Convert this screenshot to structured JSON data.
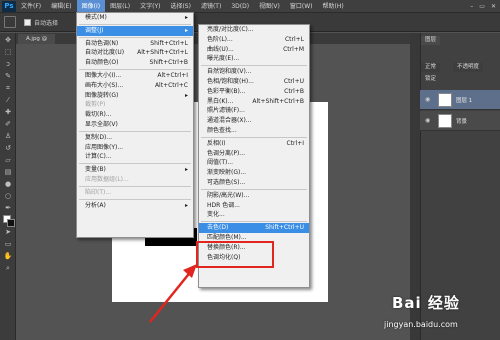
{
  "app": {
    "logo_text": "Ps"
  },
  "menubar": {
    "items": [
      "文件(F)",
      "编辑(E)",
      "图像(I)",
      "图层(L)",
      "文字(Y)",
      "选择(S)",
      "滤镜(T)",
      "3D(D)",
      "视图(V)",
      "窗口(W)",
      "帮助(H)"
    ],
    "active_index": 2,
    "window_controls": [
      "–",
      "▭",
      "✕"
    ]
  },
  "options_bar": {
    "auto_select_label": "自动选择"
  },
  "document": {
    "tab_label": "A.jpg @"
  },
  "image_menu": {
    "items": [
      {
        "label": "模式(M)",
        "shortcut": "",
        "submenu": true,
        "state": "normal"
      },
      {
        "sep": true
      },
      {
        "label": "调整(J)",
        "shortcut": "",
        "submenu": true,
        "state": "highlight"
      },
      {
        "sep": true
      },
      {
        "label": "自动色调(N)",
        "shortcut": "Shift+Ctrl+L",
        "state": "normal"
      },
      {
        "label": "自动对比度(U)",
        "shortcut": "Alt+Shift+Ctrl+L",
        "state": "normal"
      },
      {
        "label": "自动颜色(O)",
        "shortcut": "Shift+Ctrl+B",
        "state": "normal"
      },
      {
        "sep": true
      },
      {
        "label": "图像大小(I)...",
        "shortcut": "Alt+Ctrl+I",
        "state": "normal"
      },
      {
        "label": "画布大小(S)...",
        "shortcut": "Alt+Ctrl+C",
        "state": "normal"
      },
      {
        "label": "图像旋转(G)",
        "shortcut": "",
        "submenu": true,
        "state": "normal"
      },
      {
        "label": "裁剪(P)",
        "shortcut": "",
        "state": "disabled"
      },
      {
        "label": "裁切(R)...",
        "shortcut": "",
        "state": "normal"
      },
      {
        "label": "显示全部(V)",
        "shortcut": "",
        "state": "normal"
      },
      {
        "sep": true
      },
      {
        "label": "复制(D)...",
        "shortcut": "",
        "state": "normal"
      },
      {
        "label": "应用图像(Y)...",
        "shortcut": "",
        "state": "normal"
      },
      {
        "label": "计算(C)...",
        "shortcut": "",
        "state": "normal"
      },
      {
        "sep": true
      },
      {
        "label": "变量(B)",
        "shortcut": "",
        "submenu": true,
        "state": "normal"
      },
      {
        "label": "应用数据组(L)...",
        "shortcut": "",
        "state": "disabled"
      },
      {
        "sep": true
      },
      {
        "label": "陷印(T)...",
        "shortcut": "",
        "state": "disabled"
      },
      {
        "sep": true
      },
      {
        "label": "分析(A)",
        "shortcut": "",
        "submenu": true,
        "state": "normal"
      }
    ]
  },
  "adjust_menu": {
    "items": [
      {
        "label": "亮度/对比度(C)...",
        "shortcut": "",
        "state": "normal"
      },
      {
        "label": "色阶(L)...",
        "shortcut": "Ctrl+L",
        "state": "normal"
      },
      {
        "label": "曲线(U)...",
        "shortcut": "Ctrl+M",
        "state": "normal"
      },
      {
        "label": "曝光度(E)...",
        "shortcut": "",
        "state": "normal"
      },
      {
        "sep": true
      },
      {
        "label": "自然饱和度(V)...",
        "shortcut": "",
        "state": "normal"
      },
      {
        "label": "色相/饱和度(H)...",
        "shortcut": "Ctrl+U",
        "state": "normal"
      },
      {
        "label": "色彩平衡(B)...",
        "shortcut": "Ctrl+B",
        "state": "normal"
      },
      {
        "label": "黑白(K)...",
        "shortcut": "Alt+Shift+Ctrl+B",
        "state": "normal"
      },
      {
        "label": "照片滤镜(F)...",
        "shortcut": "",
        "state": "normal"
      },
      {
        "label": "通道混合器(X)...",
        "shortcut": "",
        "state": "normal"
      },
      {
        "label": "颜色查找...",
        "shortcut": "",
        "state": "normal"
      },
      {
        "sep": true
      },
      {
        "label": "反相(I)",
        "shortcut": "Ctrl+I",
        "state": "normal"
      },
      {
        "label": "色调分离(P)...",
        "shortcut": "",
        "state": "normal"
      },
      {
        "label": "阈值(T)...",
        "shortcut": "",
        "state": "normal"
      },
      {
        "label": "渐变映射(G)...",
        "shortcut": "",
        "state": "normal"
      },
      {
        "label": "可选颜色(S)...",
        "shortcut": "",
        "state": "normal"
      },
      {
        "sep": true
      },
      {
        "label": "阴影/高光(W)...",
        "shortcut": "",
        "state": "normal"
      },
      {
        "label": "HDR 色调...",
        "shortcut": "",
        "state": "normal"
      },
      {
        "label": "变化...",
        "shortcut": "",
        "state": "normal"
      },
      {
        "sep": true
      },
      {
        "label": "去色(D)",
        "shortcut": "Shift+Ctrl+U",
        "state": "highlight"
      },
      {
        "label": "匹配颜色(M)...",
        "shortcut": "",
        "state": "normal"
      },
      {
        "label": "替换颜色(R)...",
        "shortcut": "",
        "state": "normal"
      },
      {
        "label": "色调均化(Q)",
        "shortcut": "",
        "state": "normal"
      }
    ]
  },
  "panels": {
    "tab_label": "图层",
    "blend_mode": "正常",
    "opacity_label": "不透明度",
    "lock_label": "锁定",
    "layers": [
      {
        "name": "图层 1",
        "selected": true
      },
      {
        "name": "背景",
        "selected": false
      }
    ]
  },
  "watermark": {
    "logo": "Bai 经验",
    "url": "jingyan.baidu.com"
  },
  "colors": {
    "highlight": "#3a8ee6",
    "annotation_red": "#e0261e"
  }
}
